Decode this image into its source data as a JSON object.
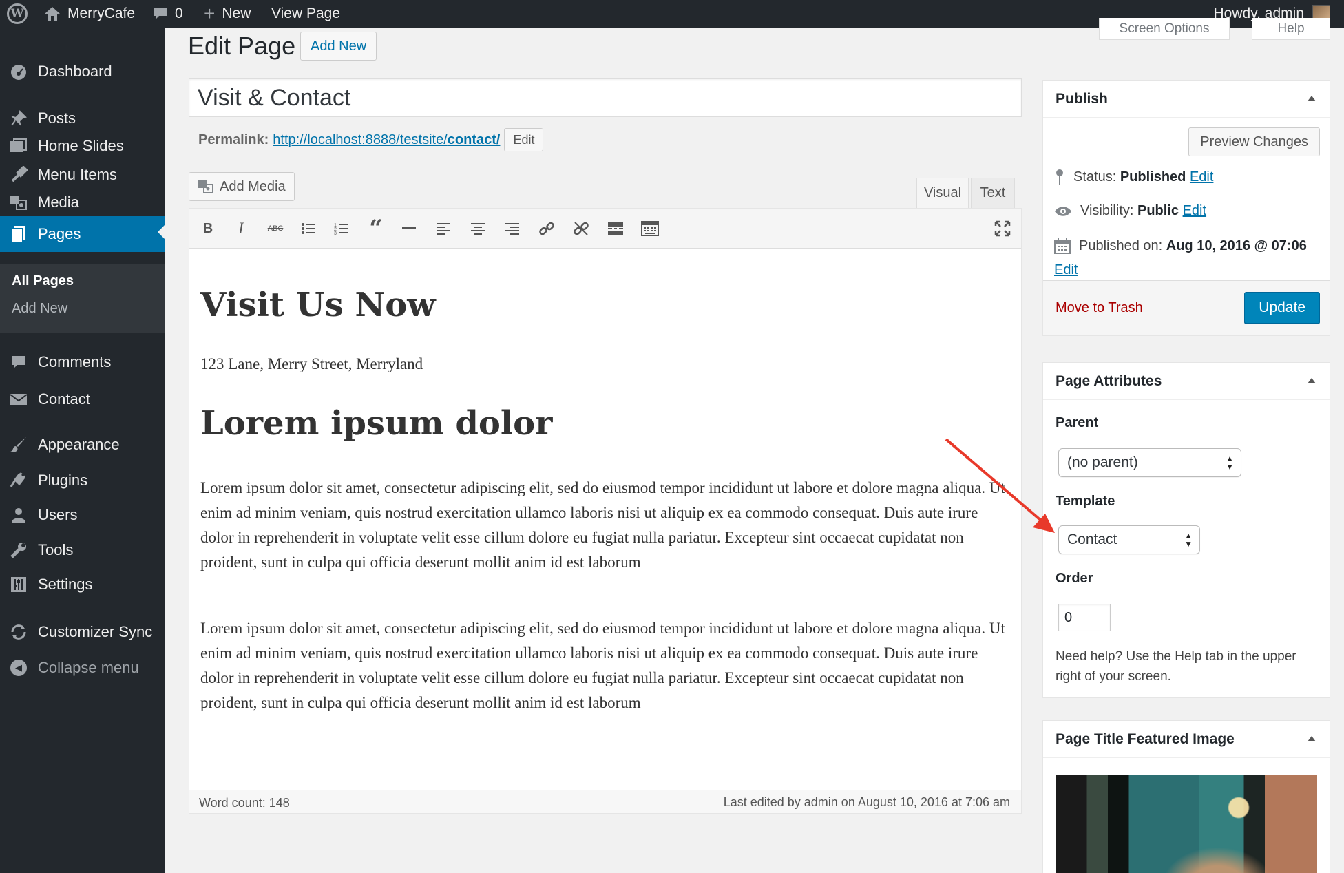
{
  "adminbar": {
    "site_name": "MerryCafe",
    "comments_count": "0",
    "new_label": "New",
    "view_page": "View Page",
    "howdy": "Howdy, admin"
  },
  "sidebar": {
    "items": [
      {
        "label": "Dashboard",
        "icon": "dashboard-icon"
      },
      {
        "label": "Posts",
        "icon": "pin-icon"
      },
      {
        "label": "Home Slides",
        "icon": "slides-icon"
      },
      {
        "label": "Menu Items",
        "icon": "tools-icon"
      },
      {
        "label": "Media",
        "icon": "media-icon"
      },
      {
        "label": "Pages",
        "icon": "page-icon"
      },
      {
        "label": "Comments",
        "icon": "comment-icon"
      },
      {
        "label": "Contact",
        "icon": "mail-icon"
      },
      {
        "label": "Appearance",
        "icon": "brush-icon"
      },
      {
        "label": "Plugins",
        "icon": "plugin-icon"
      },
      {
        "label": "Users",
        "icon": "user-icon"
      },
      {
        "label": "Tools",
        "icon": "wrench-icon"
      },
      {
        "label": "Settings",
        "icon": "settings-icon"
      },
      {
        "label": "Customizer Sync",
        "icon": "sync-icon"
      }
    ],
    "submenu": [
      "All Pages",
      "Add New"
    ],
    "collapse": "Collapse menu"
  },
  "screen_tabs": [
    "Screen Options",
    "Help"
  ],
  "header": {
    "title": "Edit Page",
    "add_new": "Add New"
  },
  "post": {
    "title": "Visit & Contact",
    "permalink_label": "Permalink:",
    "permalink_base": "http://localhost:8888/testsite/",
    "permalink_slug": "contact/",
    "permalink_edit": "Edit"
  },
  "editor": {
    "add_media": "Add Media",
    "tab_visual": "Visual",
    "tab_text": "Text",
    "heading1": "Visit Us Now",
    "address": "123 Lane, Merry Street, Merryland",
    "heading2": "Lorem ipsum dolor",
    "paragraph1": "Lorem ipsum dolor sit amet, consectetur adipiscing elit, sed do eiusmod tempor incididunt ut labore et dolore magna aliqua. Ut enim ad minim veniam, quis nostrud exercitation ullamco laboris nisi ut aliquip ex ea commodo consequat. Duis aute irure dolor in reprehenderit in voluptate velit esse cillum dolore eu fugiat nulla pariatur. Excepteur sint occaecat cupidatat non proident, sunt in culpa qui officia deserunt mollit anim id est laborum",
    "paragraph2": "Lorem ipsum dolor sit amet, consectetur adipiscing elit, sed do eiusmod tempor incididunt ut labore et dolore magna aliqua. Ut enim ad minim veniam, quis nostrud exercitation ullamco laboris nisi ut aliquip ex ea commodo consequat. Duis aute irure dolor in reprehenderit in voluptate velit esse cillum dolore eu fugiat nulla pariatur. Excepteur sint occaecat cupidatat non proident, sunt in culpa qui officia deserunt mollit anim id est laborum",
    "word_count": "Word count: 148",
    "last_edited": "Last edited by admin on August 10, 2016 at 7:06 am",
    "toolbar_icons": [
      "bold-icon",
      "italic-icon",
      "strikethrough-icon",
      "bullet-list-icon",
      "numbered-list-icon",
      "blockquote-icon",
      "horizontal-rule-icon",
      "align-left-icon",
      "align-center-icon",
      "align-right-icon",
      "link-icon",
      "unlink-icon",
      "read-more-icon",
      "toolbar-toggle-icon",
      "fullscreen-icon"
    ]
  },
  "publish": {
    "title": "Publish",
    "preview": "Preview Changes",
    "status_label": "Status:",
    "status_value": "Published",
    "visibility_label": "Visibility:",
    "visibility_value": "Public",
    "published_label": "Published on:",
    "published_value": "Aug 10, 2016 @ 07:06",
    "edit": "Edit",
    "trash": "Move to Trash",
    "update": "Update"
  },
  "attributes": {
    "title": "Page Attributes",
    "parent_label": "Parent",
    "parent_value": "(no parent)",
    "template_label": "Template",
    "template_value": "Contact",
    "order_label": "Order",
    "order_value": "0",
    "help": "Need help? Use the Help tab in the upper right of your screen."
  },
  "featured": {
    "title": "Page Title Featured Image"
  },
  "colors": {
    "accent": "#0073aa",
    "adminbar": "#23282d",
    "update_button": "#0085ba",
    "trash": "#aa0000",
    "annotation_arrow": "#e8392a"
  }
}
